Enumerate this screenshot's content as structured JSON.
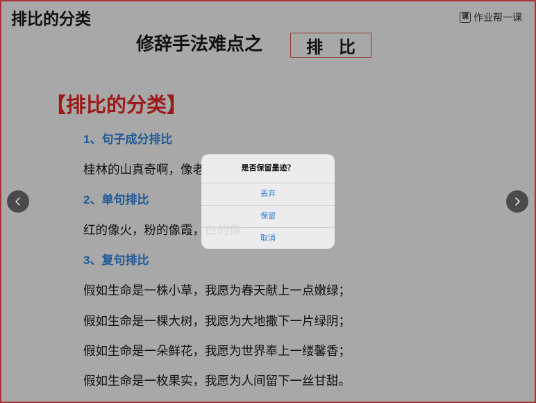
{
  "slide": {
    "corner_title": "排比的分类",
    "brand": {
      "icon_char": "课",
      "name": "作业帮一课"
    },
    "headline": "修辞手法难点之",
    "topic_box": "排 比",
    "section_title": "【排比的分类】",
    "sections": [
      {
        "heading": "1、句子成分排比",
        "lines": [
          "桂林的山真奇啊，像老"
        ]
      },
      {
        "heading": "2、单句排比",
        "lines": [
          "红的像火，粉的像霞，白的像"
        ]
      },
      {
        "heading": "3、复句排比",
        "lines": [
          "假如生命是一株小草，我愿为春天献上一点嫩绿；",
          "假如生命是一棵大树，我愿为大地撒下一片绿阴；",
          "假如生命是一朵鲜花，我愿为世界奉上一缕馨香；",
          "假如生命是一枚果实，我愿为人间留下一丝甘甜。"
        ]
      }
    ]
  },
  "nav": {
    "prev_icon": "chevron-left-icon",
    "next_icon": "chevron-right-icon"
  },
  "dialog": {
    "title": "是否保留墨迹？",
    "options": [
      "丢弃",
      "保留",
      "取消"
    ]
  },
  "colors": {
    "heading": "#2f88e8",
    "section_title": "#ec2626",
    "topic_border": "#e65252",
    "dialog_action": "#2f7fd6",
    "frame": "#a83232"
  }
}
